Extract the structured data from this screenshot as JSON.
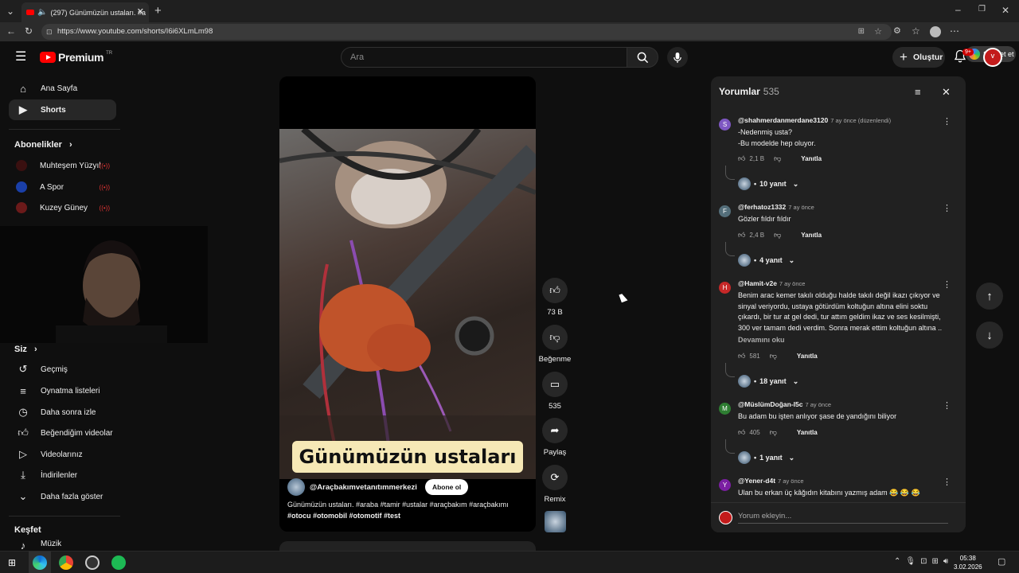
{
  "browser": {
    "tab_title": "(297) Günümüzün ustaları. #a",
    "url": "https://www.youtube.com/shorts/I6i6XLmLm98",
    "copilot_label": "Sohbet et"
  },
  "header": {
    "logo_text": "Premium",
    "logo_region": "TR",
    "search_placeholder": "Ara",
    "create_label": "Oluştur",
    "notification_count": "9+",
    "avatar_text": "V"
  },
  "sidebar": {
    "main": [
      {
        "label": "Ana Sayfa",
        "icon": "home-icon"
      },
      {
        "label": "Shorts",
        "icon": "shorts-icon"
      }
    ],
    "subscriptions_title": "Abonelikler",
    "subscriptions": [
      {
        "label": "Muhteşem Yüzyıl",
        "color": "#3a1010"
      },
      {
        "label": "A Spor",
        "color": "#1a3fa8"
      },
      {
        "label": "Kuzey Güney",
        "color": "#6b1a1a"
      }
    ],
    "you_title": "Siz",
    "you_items": [
      {
        "label": "Geçmiş",
        "icon": "history-icon"
      },
      {
        "label": "Oynatma listeleri",
        "icon": "playlist-icon"
      },
      {
        "label": "Daha sonra izle",
        "icon": "clock-icon"
      },
      {
        "label": "Beğendiğim videolar",
        "icon": "thumb-up-icon"
      },
      {
        "label": "Videolarınız",
        "icon": "video-icon"
      },
      {
        "label": "İndirilenler",
        "icon": "download-icon"
      },
      {
        "label": "Daha fazla göster",
        "icon": "chevron-down-icon"
      }
    ],
    "explore_title": "Keşfet",
    "explore_first": "Müzik"
  },
  "video": {
    "caption": "Günümüzün ustaları",
    "channel": "@Araçbakımvetanıtımmerkezi",
    "subscribe_label": "Abone ol",
    "description_line1": "Günümüzün ustaları. #araba #tamir #ustalar #araçbakım #araçbakımı",
    "description_line2": "#otocu #otomobil #otomotif #test"
  },
  "actions": {
    "like_count": "73 B",
    "dislike_label": "Beğenme",
    "comment_count": "535",
    "share_label": "Paylaş",
    "remix_label": "Remix"
  },
  "comments": {
    "title": "Yorumlar",
    "count": "535",
    "input_placeholder": "Yorum ekleyin...",
    "reply_label": "Yanıtla",
    "items": [
      {
        "user": "@shahmerdanmerdane3120",
        "time": "7 ay önce (düzenlendi)",
        "initial": "S",
        "color": "#7e57c2",
        "text": "-Nedenmiş usta?\n-Bu modelde hep oluyor.",
        "likes": "2,1 B",
        "replies": "10 yanıt"
      },
      {
        "user": "@ferhatoz1332",
        "time": "7 ay önce",
        "initial": "F",
        "color": "#546e7a",
        "text": "Gözler fıldır fıldır",
        "likes": "2,4 B",
        "replies": "4 yanıt"
      },
      {
        "user": "@Hamit-v2e",
        "time": "7 ay önce",
        "initial": "H",
        "color": "#c62828",
        "text": "Benim arac kemer takılı olduğu halde takılı değil ikazı çıkıyor ve sinyal veriyordu, ustaya götürdüm koltuğun altına elini soktu çıkardı, bir tur at gel dedi,  tur attım geldim ikaz ve ses kesilmişti, 300 ver tamam dedi verdim. Sonra merak ettim koltuğun altına ..",
        "read_more": "Devamını oku",
        "likes": "581",
        "replies": "18 yanıt"
      },
      {
        "user": "@MüslümDoğan-l5c",
        "time": "7 ay önce",
        "initial": "M",
        "color": "#2e7d32",
        "text": "Bu adam bu işten anlıyor şase de yandığını biliyor",
        "likes": "405",
        "replies": "1 yanıt"
      },
      {
        "user": "@Yener-d4t",
        "time": "7 ay önce",
        "initial": "Y",
        "color": "#7b1fa2",
        "text": "Ulan bu erkan üç kâğıdın kitabını yazmış adam 😂 😂 😂"
      }
    ]
  },
  "taskbar": {
    "time": "05:38",
    "date": "3.02.2026"
  }
}
